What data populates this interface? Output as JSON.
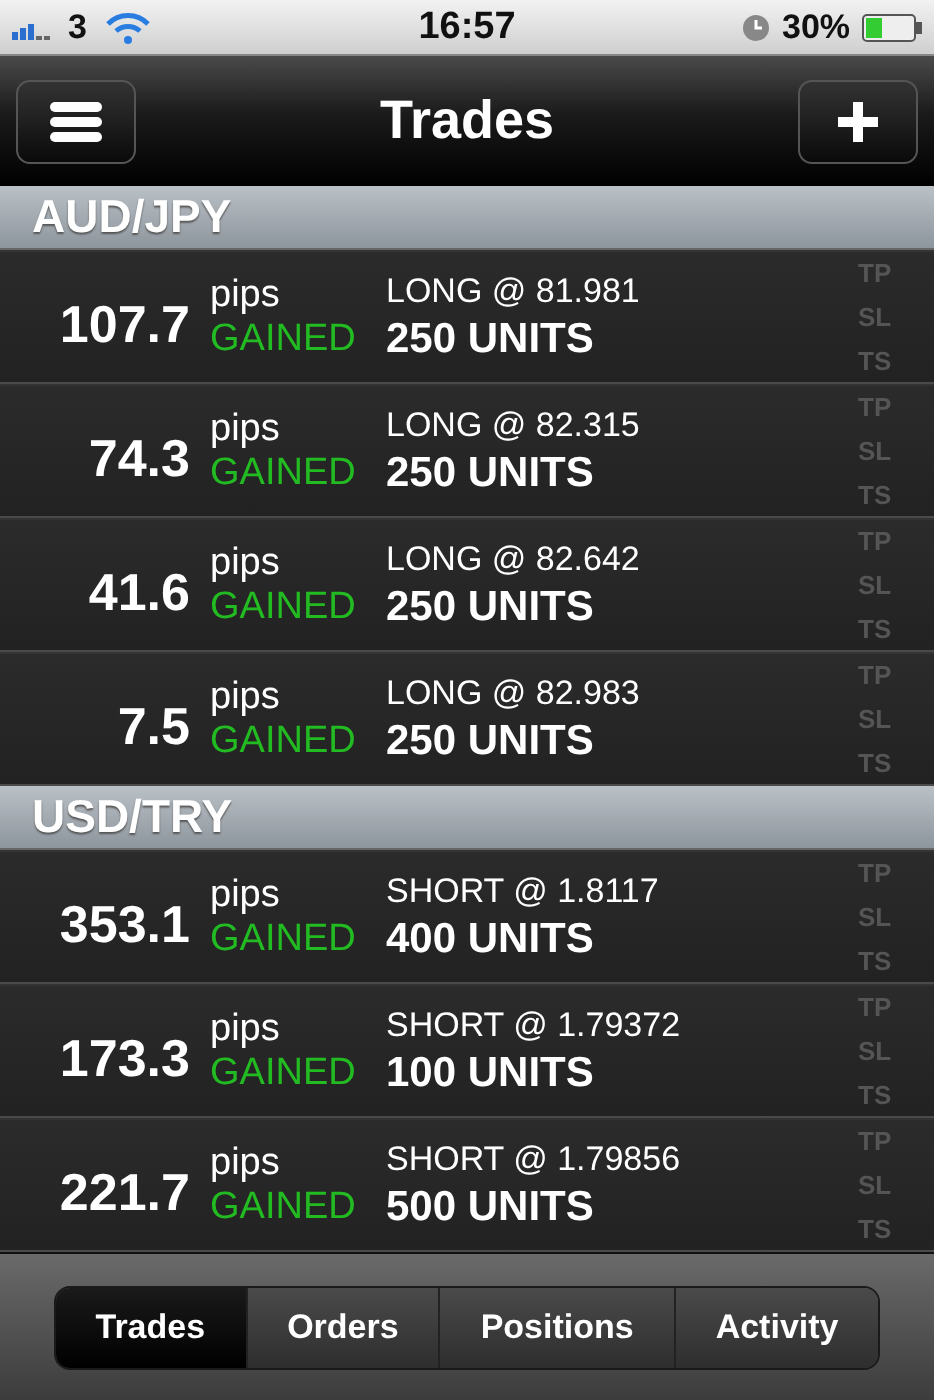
{
  "status_bar": {
    "carrier": "3",
    "time": "16:57",
    "battery": "30%"
  },
  "nav_bar": {
    "title": "Trades"
  },
  "sections": [
    {
      "title": "AUD/JPY",
      "trades": [
        {
          "pips": "107.7",
          "unit": "pips",
          "result": "GAINED",
          "side": "LONG @ 81.981",
          "units": "250 UNITS",
          "flags": [
            "TP",
            "SL",
            "TS"
          ]
        },
        {
          "pips": "74.3",
          "unit": "pips",
          "result": "GAINED",
          "side": "LONG @ 82.315",
          "units": "250 UNITS",
          "flags": [
            "TP",
            "SL",
            "TS"
          ]
        },
        {
          "pips": "41.6",
          "unit": "pips",
          "result": "GAINED",
          "side": "LONG @ 82.642",
          "units": "250 UNITS",
          "flags": [
            "TP",
            "SL",
            "TS"
          ]
        },
        {
          "pips": "7.5",
          "unit": "pips",
          "result": "GAINED",
          "side": "LONG @ 82.983",
          "units": "250 UNITS",
          "flags": [
            "TP",
            "SL",
            "TS"
          ]
        }
      ]
    },
    {
      "title": "USD/TRY",
      "trades": [
        {
          "pips": "353.1",
          "unit": "pips",
          "result": "GAINED",
          "side": "SHORT @ 1.8117",
          "units": "400 UNITS",
          "flags": [
            "TP",
            "SL",
            "TS"
          ]
        },
        {
          "pips": "173.3",
          "unit": "pips",
          "result": "GAINED",
          "side": "SHORT @ 1.79372",
          "units": "100 UNITS",
          "flags": [
            "TP",
            "SL",
            "TS"
          ]
        },
        {
          "pips": "221.7",
          "unit": "pips",
          "result": "GAINED",
          "side": "SHORT @ 1.79856",
          "units": "500 UNITS",
          "flags": [
            "TP",
            "SL",
            "TS"
          ]
        }
      ]
    }
  ],
  "tabs": [
    {
      "label": "Trades",
      "selected": true
    },
    {
      "label": "Orders",
      "selected": false
    },
    {
      "label": "Positions",
      "selected": false
    },
    {
      "label": "Activity",
      "selected": false
    }
  ]
}
